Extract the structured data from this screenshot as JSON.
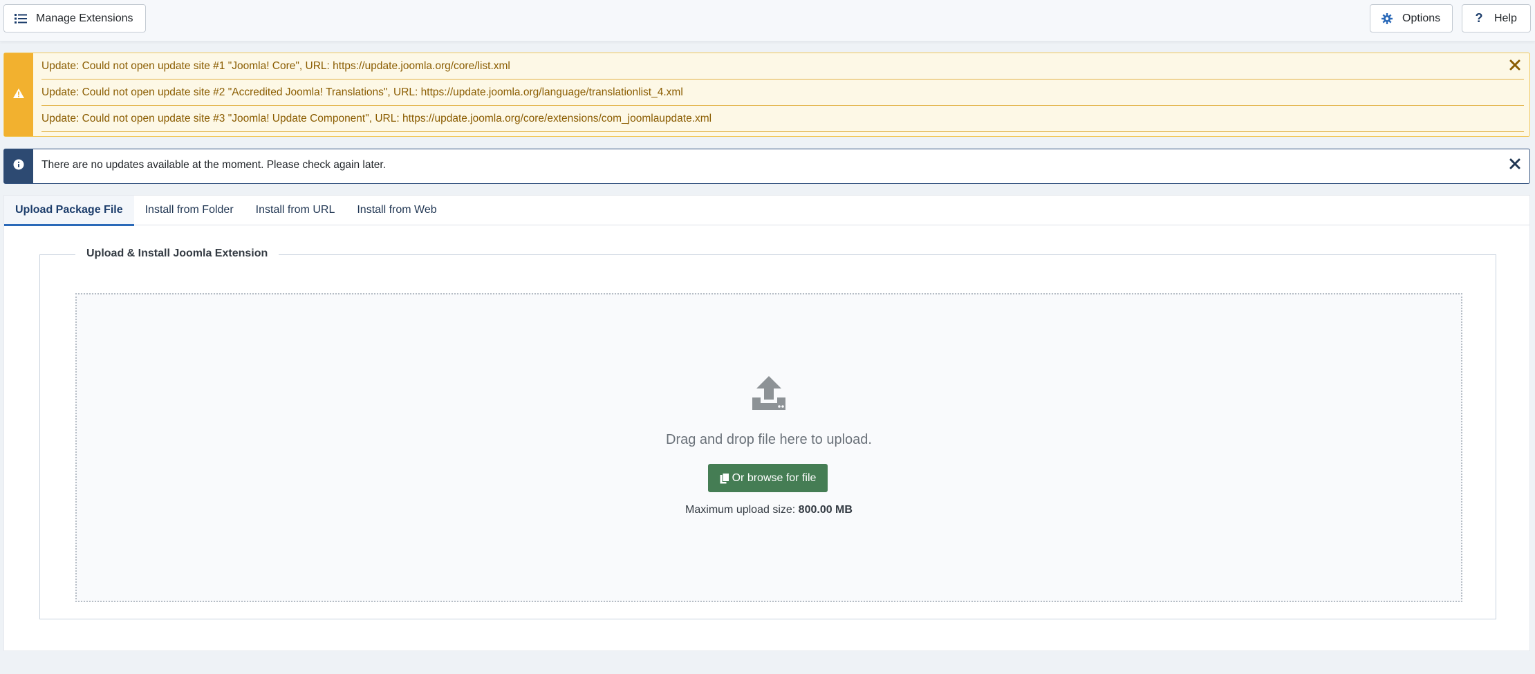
{
  "toolbar": {
    "manage_label": "Manage Extensions",
    "options_label": "Options",
    "help_label": "Help"
  },
  "warning_alert": {
    "messages": [
      "Update: Could not open update site #1 \"Joomla! Core\", URL: https://update.joomla.org/core/list.xml",
      "Update: Could not open update site #2 \"Accredited Joomla! Translations\", URL: https://update.joomla.org/language/translationlist_4.xml",
      "Update: Could not open update site #3 \"Joomla! Update Component\", URL: https://update.joomla.org/core/extensions/com_joomlaupdate.xml"
    ]
  },
  "info_alert": {
    "message": "There are no updates available at the moment. Please check again later."
  },
  "tabs": [
    {
      "label": "Upload Package File",
      "active": true
    },
    {
      "label": "Install from Folder",
      "active": false
    },
    {
      "label": "Install from URL",
      "active": false
    },
    {
      "label": "Install from Web",
      "active": false
    }
  ],
  "upload": {
    "legend": "Upload & Install Joomla Extension",
    "drop_text": "Drag and drop file here to upload.",
    "browse_label": "Or browse for file",
    "max_size_label": "Maximum upload size:",
    "max_size_value": "800.00 MB"
  },
  "colors": {
    "warning": "#f2b12f",
    "info": "#2d4a72",
    "primary_tab": "#2a69b8",
    "success_button": "#457d54"
  },
  "icons": {
    "manage": "list-icon",
    "options": "gear-icon",
    "help": "question-icon",
    "warning": "warning-triangle-icon",
    "info": "info-circle-icon",
    "close": "close-icon",
    "upload": "upload-icon",
    "browse": "copy-icon"
  }
}
